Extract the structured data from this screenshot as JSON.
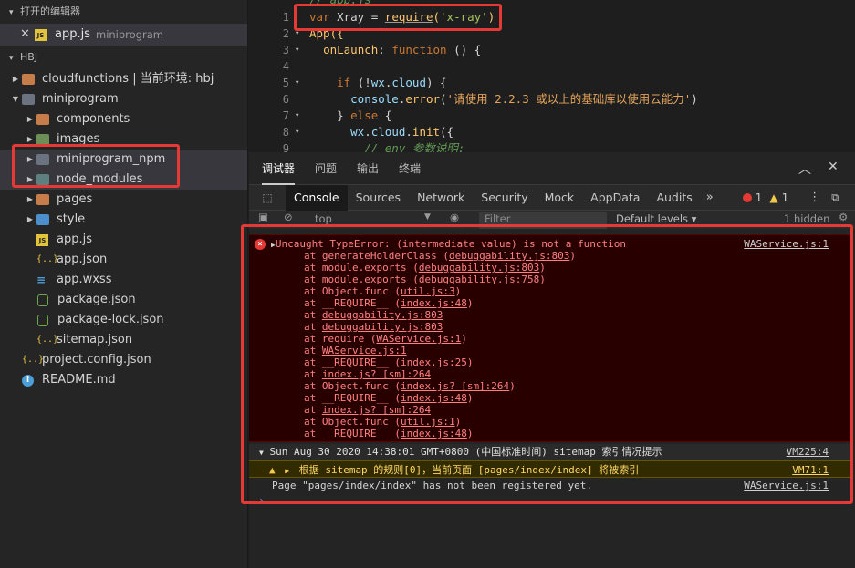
{
  "sidebar": {
    "open_editors_header": "打开的编辑器",
    "open_file": {
      "name": "app.js",
      "folder": "miniprogram"
    },
    "project_header": "HBJ",
    "tree": [
      {
        "label": "cloudfunctions | 当前环境: hbj",
        "type": "folder",
        "indent": 1,
        "color": "orange"
      },
      {
        "label": "miniprogram",
        "type": "folder-open",
        "indent": 1,
        "color": "gray"
      },
      {
        "label": "components",
        "type": "folder",
        "indent": 2,
        "color": "orange"
      },
      {
        "label": "images",
        "type": "folder",
        "indent": 2,
        "color": "green"
      },
      {
        "label": "miniprogram_npm",
        "type": "folder",
        "indent": 2,
        "color": "gray"
      },
      {
        "label": "node_modules",
        "type": "folder",
        "indent": 2,
        "color": "teal"
      },
      {
        "label": "pages",
        "type": "folder",
        "indent": 2,
        "color": "orange"
      },
      {
        "label": "style",
        "type": "folder",
        "indent": 2,
        "color": "blue"
      },
      {
        "label": "app.js",
        "type": "js",
        "indent": 2
      },
      {
        "label": "app.json",
        "type": "json",
        "indent": 2
      },
      {
        "label": "app.wxss",
        "type": "css",
        "indent": 2
      },
      {
        "label": "package.json",
        "type": "node",
        "indent": 2
      },
      {
        "label": "package-lock.json",
        "type": "node",
        "indent": 2
      },
      {
        "label": "sitemap.json",
        "type": "json",
        "indent": 2
      },
      {
        "label": "project.config.json",
        "type": "json",
        "indent": 1
      },
      {
        "label": "README.md",
        "type": "info",
        "indent": 1
      }
    ]
  },
  "editor": {
    "lines": [
      {
        "num": "",
        "text": "// app.js"
      },
      {
        "num": "1",
        "text": "var Xray = require('x-ray')"
      },
      {
        "num": "2",
        "text": "App({"
      },
      {
        "num": "3",
        "text": "  onLaunch: function () {"
      },
      {
        "num": "4",
        "text": ""
      },
      {
        "num": "5",
        "text": "    if (!wx.cloud) {"
      },
      {
        "num": "6",
        "text": "      console.error('请使用 2.2.3 或以上的基础库以使用云能力')"
      },
      {
        "num": "7",
        "text": "    } else {"
      },
      {
        "num": "8",
        "text": "      wx.cloud.init({"
      },
      {
        "num": "9",
        "text": "        // env 参数说明:"
      },
      {
        "num": "10",
        "text": ""
      }
    ]
  },
  "devtools": {
    "tabs": [
      "调试器",
      "问题",
      "输出",
      "终端"
    ],
    "panel_tabs": [
      "Console",
      "Sources",
      "Network",
      "Security",
      "Mock",
      "AppData",
      "Audits"
    ],
    "error_count": "1",
    "warning_count": "1",
    "filter": {
      "context": "top",
      "placeholder": "Filter",
      "levels": "Default levels ▾",
      "hidden": "1 hidden"
    }
  },
  "console": {
    "error_title": "Uncaught TypeError: (intermediate value) is not a function",
    "error_source": "WAService.js:1",
    "stack": [
      {
        "pre": "at generateHolderClass (",
        "link": "debuggability.js:803",
        "post": ")"
      },
      {
        "pre": "at module.exports (",
        "link": "debuggability.js:803",
        "post": ")"
      },
      {
        "pre": "at module.exports (",
        "link": "debuggability.js:758",
        "post": ")"
      },
      {
        "pre": "at Object.func (",
        "link": "util.js:3",
        "post": ")"
      },
      {
        "pre": "at __REQUIRE__ (",
        "link": "index.js:48",
        "post": ")"
      },
      {
        "pre": "at ",
        "link": "debuggability.js:803",
        "post": ""
      },
      {
        "pre": "at ",
        "link": "debuggability.js:803",
        "post": ""
      },
      {
        "pre": "at require (",
        "link": "WAService.js:1",
        "post": ")"
      },
      {
        "pre": "at ",
        "link": "WAService.js:1",
        "post": ""
      },
      {
        "pre": "at __REQUIRE__ (",
        "link": "index.js:25",
        "post": ")"
      },
      {
        "pre": "at ",
        "link": "index.js? [sm]:264",
        "post": ""
      },
      {
        "pre": "at Object.func (",
        "link": "index.js? [sm]:264",
        "post": ")"
      },
      {
        "pre": "at __REQUIRE__ (",
        "link": "index.js:48",
        "post": ")"
      },
      {
        "pre": "at ",
        "link": "index.js? [sm]:264",
        "post": ""
      },
      {
        "pre": "at Object.func (",
        "link": "util.js:1",
        "post": ")"
      },
      {
        "pre": "at __REQUIRE__ (",
        "link": "index.js:48",
        "post": ")"
      }
    ],
    "group_title": "Sun Aug 30 2020 14:38:01 GMT+0800 (中国标准时间) sitemap 索引情况提示",
    "group_source": "VM225:4",
    "warning_text": "根据 sitemap 的规则[0]，当前页面 [pages/index/index] 将被索引",
    "warning_source": "VM71:1",
    "log_text": "Page \"pages/index/index\" has not been registered yet.",
    "log_source": "WAService.js:1"
  }
}
